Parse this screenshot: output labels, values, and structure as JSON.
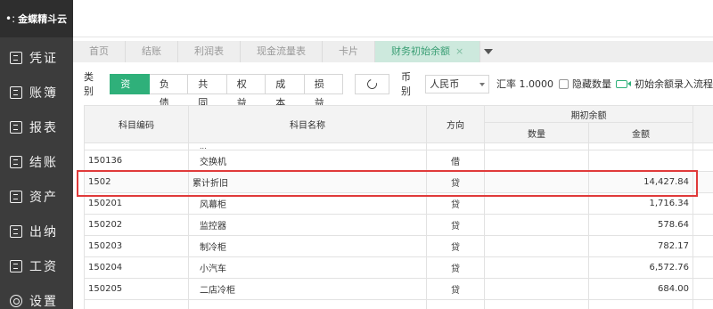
{
  "brand": {
    "name": "金蝶精斗云"
  },
  "sidebar": {
    "items": [
      {
        "label": "凭证",
        "icon": "voucher-icon"
      },
      {
        "label": "账簿",
        "icon": "ledger-icon"
      },
      {
        "label": "报表",
        "icon": "report-icon"
      },
      {
        "label": "结账",
        "icon": "closing-icon"
      },
      {
        "label": "资产",
        "icon": "asset-icon"
      },
      {
        "label": "出纳",
        "icon": "cashier-icon"
      },
      {
        "label": "工资",
        "icon": "payroll-icon"
      },
      {
        "label": "设置",
        "icon": "gear-icon"
      }
    ]
  },
  "tabs": [
    {
      "label": "首页"
    },
    {
      "label": "结账"
    },
    {
      "label": "利润表"
    },
    {
      "label": "现金流量表"
    },
    {
      "label": "卡片"
    },
    {
      "label": "财务初始余额",
      "active": true,
      "close": "×"
    }
  ],
  "filter": {
    "type_label": "类别",
    "types": [
      "资产",
      "负债",
      "共同",
      "权益",
      "成本",
      "损益"
    ],
    "active_type": "资产",
    "currency_label": "币别",
    "currency_value": "人民币",
    "rate_label": "汇率",
    "rate_value": "1.0000",
    "hide_qty_label": "隐藏数量",
    "flow_link": "初始余额录入流程"
  },
  "table": {
    "headers": {
      "code": "科目编码",
      "name": "科目名称",
      "direction": "方向",
      "opening": "期初余额",
      "quantity": "数量",
      "amount": "金额"
    },
    "partial_row": {
      "name": "...",
      "direction": ""
    },
    "rows": [
      {
        "code": "150136",
        "name": "交换机",
        "direction": "借",
        "quantity": "",
        "amount": ""
      },
      {
        "code": "1502",
        "name": "累计折旧",
        "direction": "贷",
        "quantity": "",
        "amount": "14,427.84",
        "highlight": true
      },
      {
        "code": "150201",
        "name": "风幕柜",
        "direction": "贷",
        "quantity": "",
        "amount": "1,716.34"
      },
      {
        "code": "150202",
        "name": "监控器",
        "direction": "贷",
        "quantity": "",
        "amount": "578.64"
      },
      {
        "code": "150203",
        "name": "制冷柜",
        "direction": "贷",
        "quantity": "",
        "amount": "782.17"
      },
      {
        "code": "150204",
        "name": "小汽车",
        "direction": "贷",
        "quantity": "",
        "amount": "6,572.76"
      },
      {
        "code": "150205",
        "name": "二店冷柜",
        "direction": "贷",
        "quantity": "",
        "amount": "684.00"
      },
      {
        "code": "",
        "name": "",
        "direction": "",
        "quantity": "",
        "amount": ""
      }
    ]
  },
  "colors": {
    "accent": "#2fb07a",
    "sidebar_bg": "#3c3c3c",
    "highlight_border": "#e03a3a",
    "active_tab_bg": "#cde9dd"
  }
}
